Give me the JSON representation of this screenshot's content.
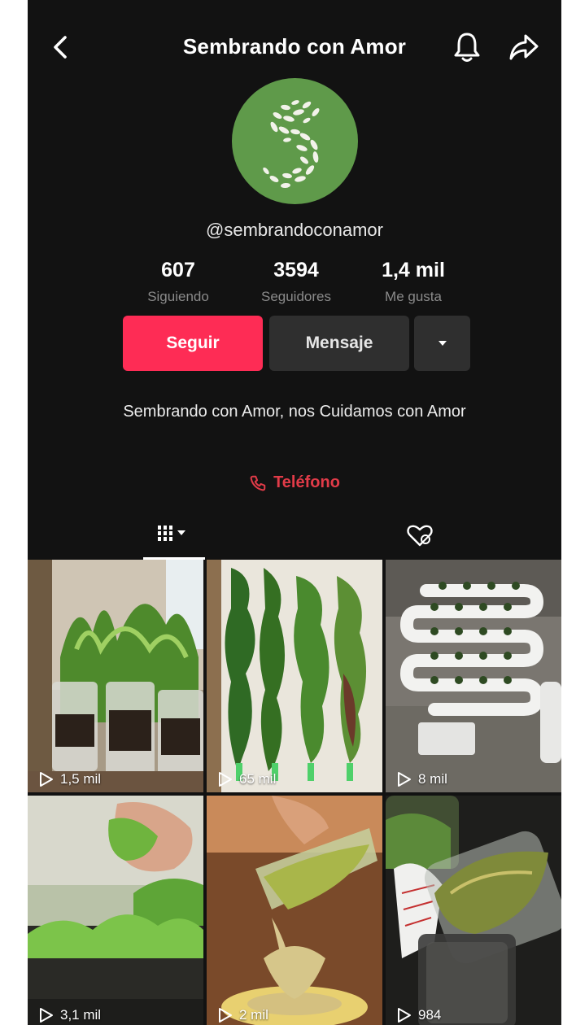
{
  "header": {
    "title": "Sembrando con Amor"
  },
  "profile": {
    "username": "@sembrandoconamor",
    "stats": {
      "following_count": "607",
      "following_label": "Siguiendo",
      "followers_count": "3594",
      "followers_label": "Seguidores",
      "likes_count": "1,4 mil",
      "likes_label": "Me gusta"
    },
    "buttons": {
      "follow_label": "Seguir",
      "message_label": "Mensaje"
    },
    "bio": "Sembrando con Amor, nos Cuidamos con Amor",
    "phone_label": "Teléfono"
  },
  "colors": {
    "background": "#121212",
    "accent_follow": "#fe2c55",
    "phone_link": "#e13b48",
    "avatar_green": "#5f9a4a"
  },
  "icons": {
    "back": "chevron-left-icon",
    "notifications": "bell-icon",
    "share": "share-arrow-icon",
    "more": "caret-down-icon",
    "phone": "phone-icon",
    "videos_tab": "grid-icon",
    "liked_tab": "hidden-heart-icon",
    "play": "play-icon"
  },
  "videos": [
    {
      "views": "1,5 mil"
    },
    {
      "views": "65 mil"
    },
    {
      "views": "8 mil"
    },
    {
      "views": "3,1 mil"
    },
    {
      "views": "2 mil"
    },
    {
      "views": "984"
    }
  ]
}
